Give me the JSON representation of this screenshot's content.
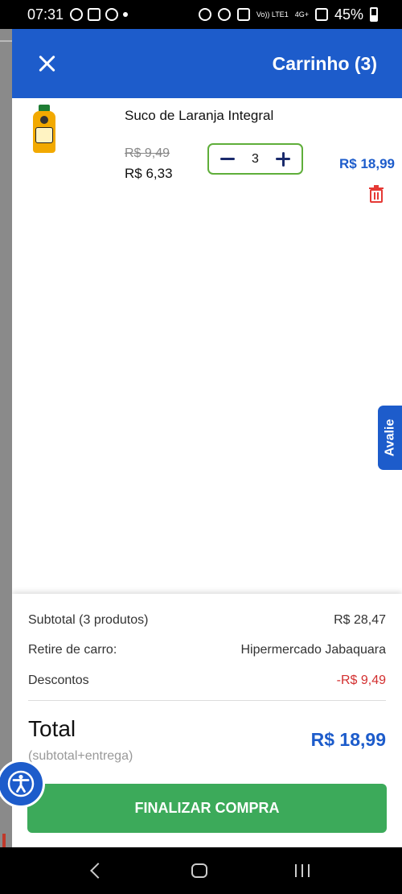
{
  "status": {
    "time": "07:31",
    "battery": "45%",
    "network": "4G+",
    "volte": "Vo)) LTE1"
  },
  "header": {
    "title": "Carrinho (3)"
  },
  "cart_item": {
    "name": "Suco de Laranja Integral",
    "old_price": "R$ 9,49",
    "new_price": "R$ 6,33",
    "quantity": "3",
    "line_total": "R$ 18,99"
  },
  "feedback_tab": "Avalie",
  "summary": {
    "subtotal_label": "Subtotal (3 produtos)",
    "subtotal_value": "R$ 28,47",
    "pickup_label": "Retire de carro:",
    "pickup_value": "Hipermercado Jabaquara",
    "discount_label": "Descontos",
    "discount_value": "-R$ 9,49",
    "total_label": "Total",
    "total_sub": "(subtotal+entrega)",
    "total_value": "R$ 18,99",
    "checkout_label": "FINALIZAR COMPRA"
  },
  "colors": {
    "primary": "#1d5ccb",
    "checkout": "#3caa5a",
    "discount": "#d32f2f",
    "stepper_border": "#5fae3a"
  }
}
